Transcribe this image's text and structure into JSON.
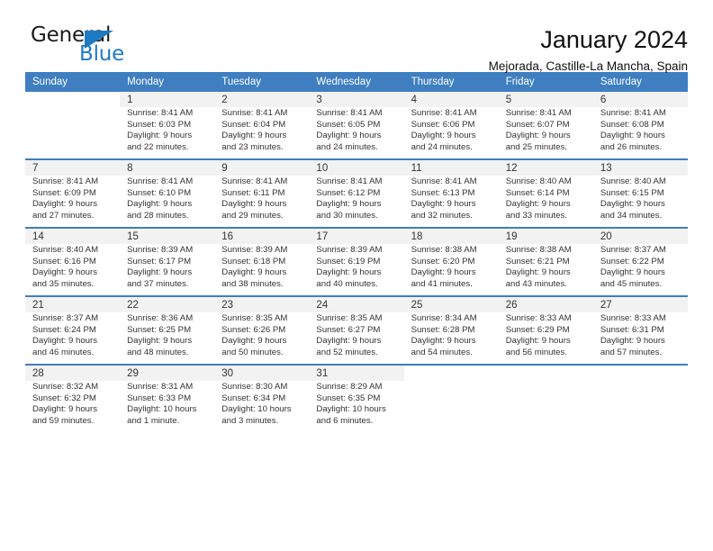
{
  "brand": {
    "name_top": "General",
    "name_bottom": "Blue",
    "accent_color": "#1f7ac4"
  },
  "header": {
    "title": "January 2024",
    "subtitle": "Mejorada, Castille-La Mancha, Spain"
  },
  "calendar": {
    "header_bg": "#3f7ec0",
    "daynum_bg": "#f2f2f2",
    "weekday_names": [
      "Sunday",
      "Monday",
      "Tuesday",
      "Wednesday",
      "Thursday",
      "Friday",
      "Saturday"
    ],
    "weeks": [
      {
        "days": [
          {
            "num": "",
            "sunrise": "",
            "sunset": "",
            "daylight_1": "",
            "daylight_2": ""
          },
          {
            "num": "1",
            "sunrise": "Sunrise: 8:41 AM",
            "sunset": "Sunset: 6:03 PM",
            "daylight_1": "Daylight: 9 hours",
            "daylight_2": "and 22 minutes."
          },
          {
            "num": "2",
            "sunrise": "Sunrise: 8:41 AM",
            "sunset": "Sunset: 6:04 PM",
            "daylight_1": "Daylight: 9 hours",
            "daylight_2": "and 23 minutes."
          },
          {
            "num": "3",
            "sunrise": "Sunrise: 8:41 AM",
            "sunset": "Sunset: 6:05 PM",
            "daylight_1": "Daylight: 9 hours",
            "daylight_2": "and 24 minutes."
          },
          {
            "num": "4",
            "sunrise": "Sunrise: 8:41 AM",
            "sunset": "Sunset: 6:06 PM",
            "daylight_1": "Daylight: 9 hours",
            "daylight_2": "and 24 minutes."
          },
          {
            "num": "5",
            "sunrise": "Sunrise: 8:41 AM",
            "sunset": "Sunset: 6:07 PM",
            "daylight_1": "Daylight: 9 hours",
            "daylight_2": "and 25 minutes."
          },
          {
            "num": "6",
            "sunrise": "Sunrise: 8:41 AM",
            "sunset": "Sunset: 6:08 PM",
            "daylight_1": "Daylight: 9 hours",
            "daylight_2": "and 26 minutes."
          }
        ]
      },
      {
        "days": [
          {
            "num": "7",
            "sunrise": "Sunrise: 8:41 AM",
            "sunset": "Sunset: 6:09 PM",
            "daylight_1": "Daylight: 9 hours",
            "daylight_2": "and 27 minutes."
          },
          {
            "num": "8",
            "sunrise": "Sunrise: 8:41 AM",
            "sunset": "Sunset: 6:10 PM",
            "daylight_1": "Daylight: 9 hours",
            "daylight_2": "and 28 minutes."
          },
          {
            "num": "9",
            "sunrise": "Sunrise: 8:41 AM",
            "sunset": "Sunset: 6:11 PM",
            "daylight_1": "Daylight: 9 hours",
            "daylight_2": "and 29 minutes."
          },
          {
            "num": "10",
            "sunrise": "Sunrise: 8:41 AM",
            "sunset": "Sunset: 6:12 PM",
            "daylight_1": "Daylight: 9 hours",
            "daylight_2": "and 30 minutes."
          },
          {
            "num": "11",
            "sunrise": "Sunrise: 8:41 AM",
            "sunset": "Sunset: 6:13 PM",
            "daylight_1": "Daylight: 9 hours",
            "daylight_2": "and 32 minutes."
          },
          {
            "num": "12",
            "sunrise": "Sunrise: 8:40 AM",
            "sunset": "Sunset: 6:14 PM",
            "daylight_1": "Daylight: 9 hours",
            "daylight_2": "and 33 minutes."
          },
          {
            "num": "13",
            "sunrise": "Sunrise: 8:40 AM",
            "sunset": "Sunset: 6:15 PM",
            "daylight_1": "Daylight: 9 hours",
            "daylight_2": "and 34 minutes."
          }
        ]
      },
      {
        "days": [
          {
            "num": "14",
            "sunrise": "Sunrise: 8:40 AM",
            "sunset": "Sunset: 6:16 PM",
            "daylight_1": "Daylight: 9 hours",
            "daylight_2": "and 35 minutes."
          },
          {
            "num": "15",
            "sunrise": "Sunrise: 8:39 AM",
            "sunset": "Sunset: 6:17 PM",
            "daylight_1": "Daylight: 9 hours",
            "daylight_2": "and 37 minutes."
          },
          {
            "num": "16",
            "sunrise": "Sunrise: 8:39 AM",
            "sunset": "Sunset: 6:18 PM",
            "daylight_1": "Daylight: 9 hours",
            "daylight_2": "and 38 minutes."
          },
          {
            "num": "17",
            "sunrise": "Sunrise: 8:39 AM",
            "sunset": "Sunset: 6:19 PM",
            "daylight_1": "Daylight: 9 hours",
            "daylight_2": "and 40 minutes."
          },
          {
            "num": "18",
            "sunrise": "Sunrise: 8:38 AM",
            "sunset": "Sunset: 6:20 PM",
            "daylight_1": "Daylight: 9 hours",
            "daylight_2": "and 41 minutes."
          },
          {
            "num": "19",
            "sunrise": "Sunrise: 8:38 AM",
            "sunset": "Sunset: 6:21 PM",
            "daylight_1": "Daylight: 9 hours",
            "daylight_2": "and 43 minutes."
          },
          {
            "num": "20",
            "sunrise": "Sunrise: 8:37 AM",
            "sunset": "Sunset: 6:22 PM",
            "daylight_1": "Daylight: 9 hours",
            "daylight_2": "and 45 minutes."
          }
        ]
      },
      {
        "days": [
          {
            "num": "21",
            "sunrise": "Sunrise: 8:37 AM",
            "sunset": "Sunset: 6:24 PM",
            "daylight_1": "Daylight: 9 hours",
            "daylight_2": "and 46 minutes."
          },
          {
            "num": "22",
            "sunrise": "Sunrise: 8:36 AM",
            "sunset": "Sunset: 6:25 PM",
            "daylight_1": "Daylight: 9 hours",
            "daylight_2": "and 48 minutes."
          },
          {
            "num": "23",
            "sunrise": "Sunrise: 8:35 AM",
            "sunset": "Sunset: 6:26 PM",
            "daylight_1": "Daylight: 9 hours",
            "daylight_2": "and 50 minutes."
          },
          {
            "num": "24",
            "sunrise": "Sunrise: 8:35 AM",
            "sunset": "Sunset: 6:27 PM",
            "daylight_1": "Daylight: 9 hours",
            "daylight_2": "and 52 minutes."
          },
          {
            "num": "25",
            "sunrise": "Sunrise: 8:34 AM",
            "sunset": "Sunset: 6:28 PM",
            "daylight_1": "Daylight: 9 hours",
            "daylight_2": "and 54 minutes."
          },
          {
            "num": "26",
            "sunrise": "Sunrise: 8:33 AM",
            "sunset": "Sunset: 6:29 PM",
            "daylight_1": "Daylight: 9 hours",
            "daylight_2": "and 56 minutes."
          },
          {
            "num": "27",
            "sunrise": "Sunrise: 8:33 AM",
            "sunset": "Sunset: 6:31 PM",
            "daylight_1": "Daylight: 9 hours",
            "daylight_2": "and 57 minutes."
          }
        ]
      },
      {
        "days": [
          {
            "num": "28",
            "sunrise": "Sunrise: 8:32 AM",
            "sunset": "Sunset: 6:32 PM",
            "daylight_1": "Daylight: 9 hours",
            "daylight_2": "and 59 minutes."
          },
          {
            "num": "29",
            "sunrise": "Sunrise: 8:31 AM",
            "sunset": "Sunset: 6:33 PM",
            "daylight_1": "Daylight: 10 hours",
            "daylight_2": "and 1 minute."
          },
          {
            "num": "30",
            "sunrise": "Sunrise: 8:30 AM",
            "sunset": "Sunset: 6:34 PM",
            "daylight_1": "Daylight: 10 hours",
            "daylight_2": "and 3 minutes."
          },
          {
            "num": "31",
            "sunrise": "Sunrise: 8:29 AM",
            "sunset": "Sunset: 6:35 PM",
            "daylight_1": "Daylight: 10 hours",
            "daylight_2": "and 6 minutes."
          },
          {
            "num": "",
            "sunrise": "",
            "sunset": "",
            "daylight_1": "",
            "daylight_2": ""
          },
          {
            "num": "",
            "sunrise": "",
            "sunset": "",
            "daylight_1": "",
            "daylight_2": ""
          },
          {
            "num": "",
            "sunrise": "",
            "sunset": "",
            "daylight_1": "",
            "daylight_2": ""
          }
        ]
      }
    ]
  }
}
